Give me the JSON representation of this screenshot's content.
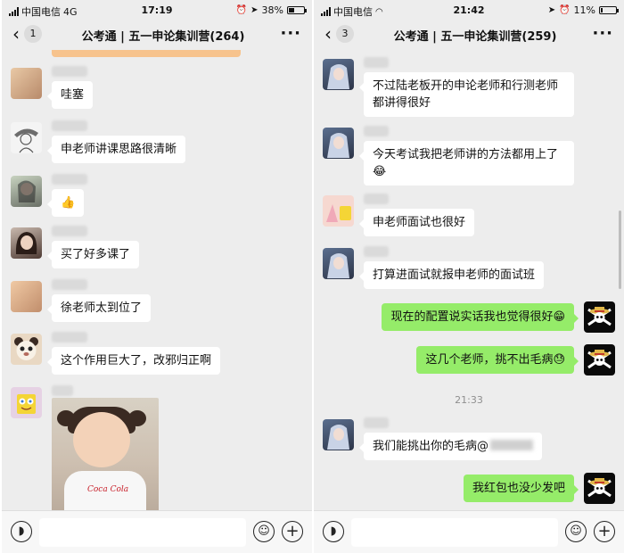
{
  "left": {
    "status": {
      "carrier": "中国电信",
      "network": "4G",
      "time": "17:19",
      "battery": "38%",
      "battery_level": 0.38
    },
    "nav": {
      "back_count": "1",
      "title": "公考通 | 五一申论集训营(264)"
    },
    "messages": [
      {
        "type": "text",
        "side": "left",
        "avatar": "photo-warm",
        "text": "哇塞"
      },
      {
        "type": "text",
        "side": "left",
        "avatar": "sketch-figure",
        "text": "申老师讲课思路很清晰"
      },
      {
        "type": "text",
        "side": "left",
        "avatar": "girl-portrait",
        "text": "👍"
      },
      {
        "type": "text",
        "side": "left",
        "avatar": "girl-portrait-2",
        "text": "买了好多课了"
      },
      {
        "type": "text",
        "side": "left",
        "avatar": "photo-warm",
        "text": "徐老师太到位了"
      },
      {
        "type": "text",
        "side": "left",
        "avatar": "panda-bear",
        "text": "这个作用巨大了，改邪归正啊"
      },
      {
        "type": "image",
        "side": "left",
        "avatar": "spongebob",
        "shirt_logo": "Coca Cola"
      }
    ]
  },
  "right": {
    "status": {
      "carrier": "中国电信",
      "time": "21:42",
      "battery": "11%",
      "battery_level": 0.11
    },
    "nav": {
      "back_count": "3",
      "title": "公考通 | 五一申论集训营(259)"
    },
    "messages": [
      {
        "side": "left",
        "avatar": "anime-character",
        "text": "不过陆老板开的申论老师和行测老师都讲得很好"
      },
      {
        "side": "left",
        "avatar": "anime-character",
        "text": "今天考试我把老师讲的方法都用上了😂"
      },
      {
        "side": "left",
        "avatar": "cartoon-pair",
        "text": "申老师面试也很好"
      },
      {
        "side": "left",
        "avatar": "anime-character",
        "text": "打算进面试就报申老师的面试班"
      },
      {
        "side": "right",
        "avatar": "straw-hat-skull",
        "text": "现在的配置说实话我也觉得很好😁"
      },
      {
        "side": "right",
        "avatar": "straw-hat-skull",
        "text": "这几个老师，挑不出毛病😓"
      },
      {
        "side": "time",
        "text": "21:33"
      },
      {
        "side": "left",
        "avatar": "anime-character",
        "text": "我们能挑出你的毛病@"
      },
      {
        "side": "right",
        "avatar": "straw-hat-skull",
        "text": "我红包也没少发吧"
      }
    ]
  },
  "icons": {
    "back": "chevron-left-icon",
    "more": "more-dots-icon",
    "voice": "voice-icon",
    "emoji": "emoji-face-icon",
    "plus": "plus-icon",
    "location": "location-arrow-icon",
    "alarm": "alarm-icon",
    "mute": "mute-bell-icon",
    "wifi": "wifi-icon"
  },
  "colors": {
    "chat_bg": "#ededed",
    "self_bubble": "#95ec69",
    "other_bubble": "#ffffff"
  }
}
